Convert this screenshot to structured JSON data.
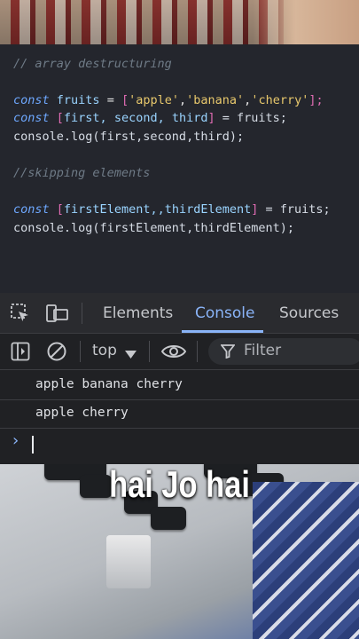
{
  "editor": {
    "comment1": "// array destructuring",
    "line1": {
      "kw": "const",
      "id": "fruits",
      "op": " = ",
      "open": "[",
      "s1": "'apple'",
      "s2": "'banana'",
      "s3": "'cherry'",
      "close": "];"
    },
    "line2": {
      "kw": "const",
      "open": "[",
      "vars": "first, second, third",
      "close": "]",
      "rest": " = fruits;"
    },
    "line3": "console.log(first,second,third);",
    "comment2": "//skipping elements",
    "line4": {
      "kw": "const",
      "open": "[",
      "vars": "firstElement,,thirdElement",
      "close": "]",
      "rest": " = fruits;"
    },
    "line5": "console.log(firstElement,thirdElement);"
  },
  "devtools": {
    "tabs": [
      "Elements",
      "Console",
      "Sources"
    ],
    "active_tab": "Console",
    "context": "top",
    "filter_placeholder": "Filter",
    "output": [
      "apple banana cherry",
      "apple cherry"
    ],
    "prompt": "›"
  },
  "caption": "hai Jo hai",
  "colors": {
    "accent": "#8ab4f8",
    "editor_bg": "#24262d",
    "devtools_bg": "#202124"
  }
}
